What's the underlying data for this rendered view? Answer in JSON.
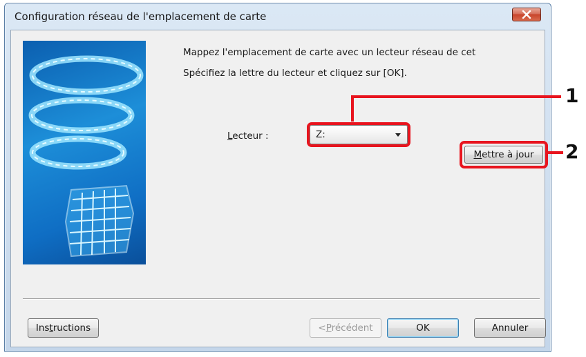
{
  "window": {
    "title": "Configuration réseau de l'emplacement de carte"
  },
  "message": {
    "line1": "Mappez l'emplacement de carte avec un lecteur réseau de cet",
    "line2": "Spécifiez la lettre du lecteur et cliquez sur [OK]."
  },
  "drive": {
    "label_prefix": "L",
    "label_rest": "ecteur :",
    "selected": "Z:"
  },
  "buttons": {
    "update": {
      "u": "M",
      "rest": "ettre à jour"
    },
    "instructions": {
      "pre": "Ins",
      "u": "t",
      "rest": "ructions"
    },
    "previous": {
      "pre": "<",
      "u": "P",
      "rest": "récédent"
    },
    "ok": "OK",
    "cancel": "Annuler"
  },
  "callouts": {
    "drive_combo": "1",
    "update_button": "2"
  },
  "colors": {
    "highlight": "#e8141e"
  }
}
